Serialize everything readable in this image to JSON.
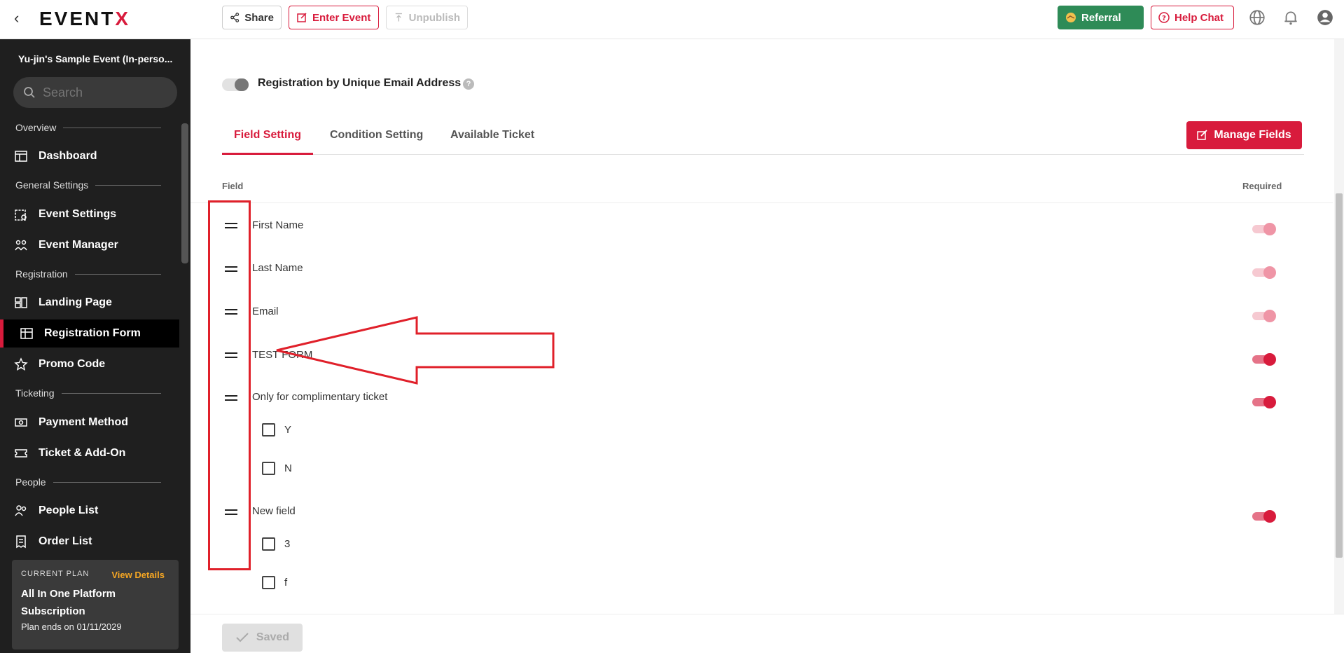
{
  "header": {
    "logo_main": "EVENT",
    "logo_accent": "X",
    "share_label": "Share",
    "enter_event_label": "Enter Event",
    "unpublish_label": "Unpublish",
    "referral_label": "Referral",
    "help_chat_label": "Help Chat"
  },
  "sidebar": {
    "event_title": "Yu-jin's Sample Event (In-perso...",
    "search_placeholder": "Search",
    "sections": {
      "overview": "Overview",
      "general": "General Settings",
      "registration": "Registration",
      "ticketing": "Ticketing",
      "people": "People"
    },
    "items": {
      "dashboard": "Dashboard",
      "event_settings": "Event Settings",
      "event_manager": "Event Manager",
      "landing_page": "Landing Page",
      "registration_form": "Registration Form",
      "promo_code": "Promo Code",
      "payment_method": "Payment Method",
      "ticket_addon": "Ticket & Add-On",
      "people_list": "People List",
      "order_list": "Order List"
    },
    "plan": {
      "label": "CURRENT PLAN",
      "view_details": "View Details",
      "name": "All In One Platform Subscription",
      "ends": "Plan ends on 01/11/2029"
    }
  },
  "main": {
    "unique_email_label": "Registration by Unique Email Address",
    "tabs": [
      "Field Setting",
      "Condition Setting",
      "Available Ticket"
    ],
    "manage_fields_label": "Manage Fields",
    "col_field": "Field",
    "col_required": "Required",
    "fields": {
      "first_name": "First Name",
      "last_name": "Last Name",
      "email": "Email",
      "test_form": "TEST FORM",
      "complimentary": "Only for complimentary ticket",
      "complimentary_options": [
        "Y",
        "N"
      ],
      "new_field": "New field",
      "new_field_options": [
        "3",
        "f"
      ]
    },
    "saved_label": "Saved"
  },
  "colors": {
    "brand": "#d81b3c",
    "referral": "#2e8b57",
    "sidebar_bg": "#1f1f1f",
    "annotation": "#e0202a"
  }
}
